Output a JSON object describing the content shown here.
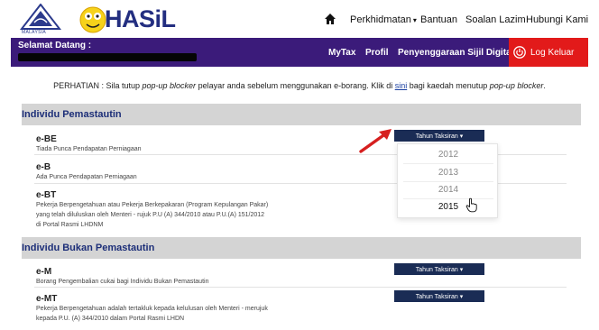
{
  "header": {
    "logo_lhdn_text": "LHDN",
    "logo_sub_text": "MALAYSIA",
    "site_title": "HASiL",
    "nav": [
      {
        "label": "Perkhidmatan",
        "has_caret": true
      },
      {
        "label": "Bantuan"
      },
      {
        "label": "Soalan Lazim"
      },
      {
        "label": "Hubungi Kami"
      }
    ]
  },
  "userbar": {
    "welcome": "Selamat Datang :",
    "nav": [
      {
        "label": "MyTax"
      },
      {
        "label": "Profil"
      },
      {
        "label": "Penyenggaraan Sijil Digital"
      }
    ],
    "logout_label": "Log Keluar",
    "colors": {
      "bar": "#3b1b7a",
      "logout": "#e21a1a"
    }
  },
  "notice": {
    "prefix": "PERHATIAN : Sila tutup ",
    "italic1": "pop-up blocker",
    "middle": " pelayar anda sebelum menggunakan e-borang. Klik di ",
    "link": "sini",
    "suffix": " bagi kaedah menutup ",
    "italic2": "pop-up blocker",
    "end": "."
  },
  "sections": [
    {
      "title": "Individu Pemastautin",
      "items": [
        {
          "name": "e-BE",
          "desc": [
            "Tiada Punca Pendapatan Perniagaan"
          ]
        },
        {
          "name": "e-B",
          "desc": [
            "Ada Punca Pendapatan Perniagaan"
          ]
        },
        {
          "name": "e-BT",
          "desc": [
            "Pekerja Berpengetahuan atau Pekerja Berkepakaran (Program Kepulangan Pakar)",
            "yang telah diluluskan oleh Menteri - rujuk P.U (A) 344/2010 atau P.U.(A) 151/2012",
            "di Portal Rasmi LHDNM"
          ]
        }
      ]
    },
    {
      "title": "Individu Bukan Pemastautin",
      "items": [
        {
          "name": "e-M",
          "desc": [
            "Borang Pengembalian cukai bagi Individu Bukan Pemastautin"
          ]
        },
        {
          "name": "e-MT",
          "desc": [
            "Pekerja Berpengetahuan adalah tertakluk kepada kelulusan oleh Menteri - merujuk",
            "kepada P.U. (A) 344/2010 dalam Portal Rasmi LHDN"
          ]
        }
      ]
    }
  ],
  "tahun_button_label": "Tahun Taksiran",
  "tahun_caret": "▾",
  "dropdown": {
    "options": [
      "2012",
      "2013",
      "2014",
      "2015"
    ],
    "selected": "2015"
  },
  "icons": {
    "home": "home-icon",
    "logout": "power-icon",
    "arrow": "red-arrow-annotation",
    "cursor": "hand-pointer-cursor"
  },
  "colors": {
    "accent_blue": "#1c2e78",
    "button": "#1a2c55",
    "arrow": "#d61f1f"
  }
}
